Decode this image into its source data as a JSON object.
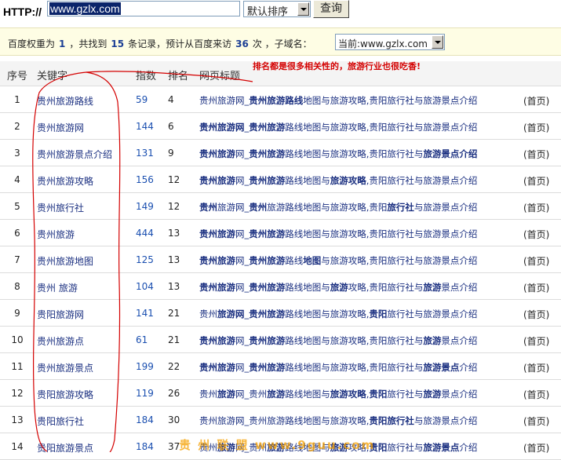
{
  "topbar": {
    "http_label": "HTTP://",
    "url_value": "www.gzlx.com",
    "sort_selected": "默认排序",
    "query_label": "查询"
  },
  "info": {
    "weight_label": "百度权重为",
    "weight_value": "1",
    "found_label": "，共找到",
    "found_value": "15",
    "records_label": "条记录，预计从百度来访",
    "visits_value": "36",
    "visits_label": "次 ，子域名：",
    "domain_selected": "当前:www.gzlx.com"
  },
  "table": {
    "headers": {
      "idx": "序号",
      "keyword": "关键字",
      "index": "指数",
      "rank": "排名",
      "title": "网页标题"
    },
    "rows": [
      {
        "idx": "1",
        "keyword": "贵州旅游路线",
        "index": "59",
        "rank": "4",
        "home": "(首页)"
      },
      {
        "idx": "2",
        "keyword": "贵州旅游网",
        "index": "144",
        "rank": "6",
        "home": "(首页)"
      },
      {
        "idx": "3",
        "keyword": "贵州旅游景点介绍",
        "index": "131",
        "rank": "9",
        "home": "(首页)"
      },
      {
        "idx": "4",
        "keyword": "贵州旅游攻略",
        "index": "156",
        "rank": "12",
        "home": "(首页)"
      },
      {
        "idx": "5",
        "keyword": "贵州旅行社",
        "index": "149",
        "rank": "12",
        "home": "(首页)"
      },
      {
        "idx": "6",
        "keyword": "贵州旅游",
        "index": "444",
        "rank": "13",
        "home": "(首页)"
      },
      {
        "idx": "7",
        "keyword": "贵州旅游地图",
        "index": "125",
        "rank": "13",
        "home": "(首页)"
      },
      {
        "idx": "8",
        "keyword": "贵州 旅游",
        "index": "104",
        "rank": "13",
        "home": "(首页)"
      },
      {
        "idx": "9",
        "keyword": "贵阳旅游网",
        "index": "141",
        "rank": "21",
        "home": "(首页)"
      },
      {
        "idx": "10",
        "keyword": "贵州旅游点",
        "index": "61",
        "rank": "21",
        "home": "(首页)"
      },
      {
        "idx": "11",
        "keyword": "贵州旅游景点",
        "index": "199",
        "rank": "22",
        "home": "(首页)"
      },
      {
        "idx": "12",
        "keyword": "贵阳旅游攻略",
        "index": "119",
        "rank": "26",
        "home": "(首页)"
      },
      {
        "idx": "13",
        "keyword": "贵阳旅行社",
        "index": "184",
        "rank": "30",
        "home": "(首页)"
      },
      {
        "idx": "14",
        "keyword": "贵阳旅游景点",
        "index": "184",
        "rank": "37",
        "home": "(首页)"
      }
    ],
    "title_segments": [
      [
        [
          "贵州旅游网_",
          0
        ],
        [
          "贵州旅游路线",
          1
        ],
        [
          "地图与旅游攻略,贵阳旅行社与旅游景点介绍",
          0
        ]
      ],
      [
        [
          "贵州旅游网",
          1
        ],
        [
          "_",
          0
        ],
        [
          "贵州旅游",
          1
        ],
        [
          "路线地图与旅游攻略,贵阳旅行社与旅游景点介绍",
          0
        ]
      ],
      [
        [
          "贵州旅游",
          1
        ],
        [
          "网_",
          0
        ],
        [
          "贵州旅游",
          1
        ],
        [
          "路线地图与旅游攻略,贵阳旅行社与",
          0
        ],
        [
          "旅游景点介绍",
          1
        ]
      ],
      [
        [
          "贵州旅游",
          1
        ],
        [
          "网_",
          0
        ],
        [
          "贵州旅游",
          1
        ],
        [
          "路线地图与",
          0
        ],
        [
          "旅游攻略",
          1
        ],
        [
          ",贵阳旅行社与旅游景点介绍",
          0
        ]
      ],
      [
        [
          "贵州",
          1
        ],
        [
          "旅游网_",
          0
        ],
        [
          "贵州",
          1
        ],
        [
          "旅游路线地图与旅游攻略,贵阳",
          0
        ],
        [
          "旅行社",
          1
        ],
        [
          "与旅游景点介绍",
          0
        ]
      ],
      [
        [
          "贵州旅游",
          1
        ],
        [
          "网_",
          0
        ],
        [
          "贵州旅游",
          1
        ],
        [
          "路线地图与旅游攻略,贵阳旅行社与旅游景点介绍",
          0
        ]
      ],
      [
        [
          "贵州旅游",
          1
        ],
        [
          "网_",
          0
        ],
        [
          "贵州旅游",
          1
        ],
        [
          "路线",
          0
        ],
        [
          "地图",
          1
        ],
        [
          "与旅游攻略,贵阳旅行社与旅游景点介绍",
          0
        ]
      ],
      [
        [
          "贵州旅游",
          1
        ],
        [
          "网_",
          0
        ],
        [
          "贵州旅游",
          1
        ],
        [
          "路线地图与",
          0
        ],
        [
          "旅游",
          1
        ],
        [
          "攻略,贵阳旅行社与",
          0
        ],
        [
          "旅游",
          1
        ],
        [
          "景点介绍",
          0
        ]
      ],
      [
        [
          "贵州",
          0
        ],
        [
          "旅游网",
          1
        ],
        [
          "_",
          0
        ],
        [
          "贵州旅游",
          1
        ],
        [
          "路线地图与旅游攻略,",
          0
        ],
        [
          "贵阳",
          1
        ],
        [
          "旅行社与旅游景点介绍",
          0
        ]
      ],
      [
        [
          "贵州旅游",
          1
        ],
        [
          "网_",
          0
        ],
        [
          "贵州旅游",
          1
        ],
        [
          "路线地图与旅游攻略,贵阳旅行社与",
          0
        ],
        [
          "旅游",
          1
        ],
        [
          "景点介绍",
          0
        ]
      ],
      [
        [
          "贵州旅游",
          1
        ],
        [
          "网_",
          0
        ],
        [
          "贵州旅游",
          1
        ],
        [
          "路线地图与旅游攻略,贵阳旅行社与",
          0
        ],
        [
          "旅游景点",
          1
        ],
        [
          "介绍",
          0
        ]
      ],
      [
        [
          "贵州",
          0
        ],
        [
          "旅游",
          1
        ],
        [
          "网_贵州",
          0
        ],
        [
          "旅游",
          1
        ],
        [
          "路线地图与",
          0
        ],
        [
          "旅游攻略",
          1
        ],
        [
          ",",
          0
        ],
        [
          "贵阳",
          1
        ],
        [
          "旅行社与",
          0
        ],
        [
          "旅游",
          1
        ],
        [
          "景点介绍",
          0
        ]
      ],
      [
        [
          "贵州旅游网_贵州旅游路线地图与旅游攻略,",
          0
        ],
        [
          "贵阳旅行社",
          1
        ],
        [
          "与旅游景点介绍",
          0
        ]
      ],
      [
        [
          "贵州",
          0
        ],
        [
          "旅游",
          1
        ],
        [
          "网_贵州",
          0
        ],
        [
          "旅游",
          1
        ],
        [
          "路线地图与",
          0
        ],
        [
          "旅游",
          1
        ],
        [
          "攻略,",
          0
        ],
        [
          "贵阳",
          1
        ],
        [
          "旅行社与",
          0
        ],
        [
          "旅游景点",
          1
        ],
        [
          "介绍",
          0
        ]
      ]
    ]
  },
  "annotation": {
    "note": "排名都是很多相关性的，旅游行业也很吃香!",
    "stroke_color": "#d40000"
  },
  "watermark": "贵 州 联 盟  www.9guu.com"
}
